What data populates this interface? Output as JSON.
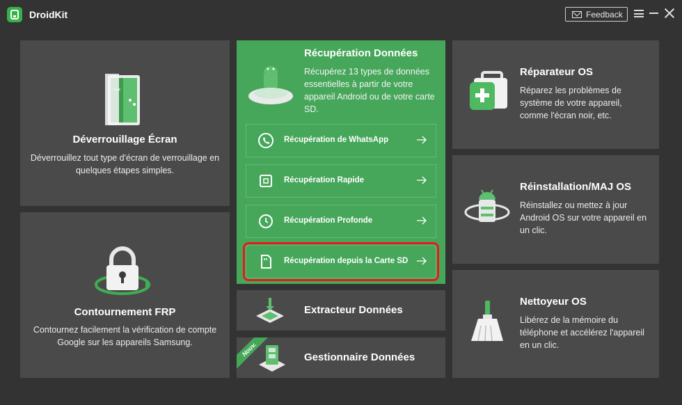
{
  "app": {
    "name": "DroidKit"
  },
  "titlebar": {
    "feedback_label": "Feedback"
  },
  "cards": {
    "unlock": {
      "title": "Déverrouillage Écran",
      "desc": "Déverrouillez tout type d'écran de verrouillage en quelques étapes simples."
    },
    "frp": {
      "title": "Contournement FRP",
      "desc": "Contournez facilement la vérification de compte Google sur les appareils Samsung."
    },
    "recovery": {
      "title": "Récupération Données",
      "desc": "Récupérez 13 types de données essentielles à partir de votre appareil Android ou de votre carte SD.",
      "items": [
        {
          "label": "Récupération de WhatsApp"
        },
        {
          "label": "Récupération Rapide"
        },
        {
          "label": "Récupération Profonde"
        },
        {
          "label": "Récupération depuis la Carte SD"
        }
      ]
    },
    "extract": {
      "title": "Extracteur Données"
    },
    "manager": {
      "title": "Gestionnaire Données",
      "badge": "Nouv."
    },
    "repair": {
      "title": "Réparateur OS",
      "desc": "Réparez les problèmes de système de votre appareil, comme l'écran noir, etc."
    },
    "reinstall": {
      "title": "Réinstallation/MAJ OS",
      "desc": "Réinstallez ou mettez à jour Android OS sur votre appareil en un clic."
    },
    "cleaner": {
      "title": "Nettoyeur OS",
      "desc": "Libérez de la mémoire du téléphone et accélérez l'appareil en un clic."
    }
  },
  "colors": {
    "accent": "#46a75a",
    "background": "#333333",
    "card": "#4a4a4a",
    "highlight": "#e51c1c"
  }
}
